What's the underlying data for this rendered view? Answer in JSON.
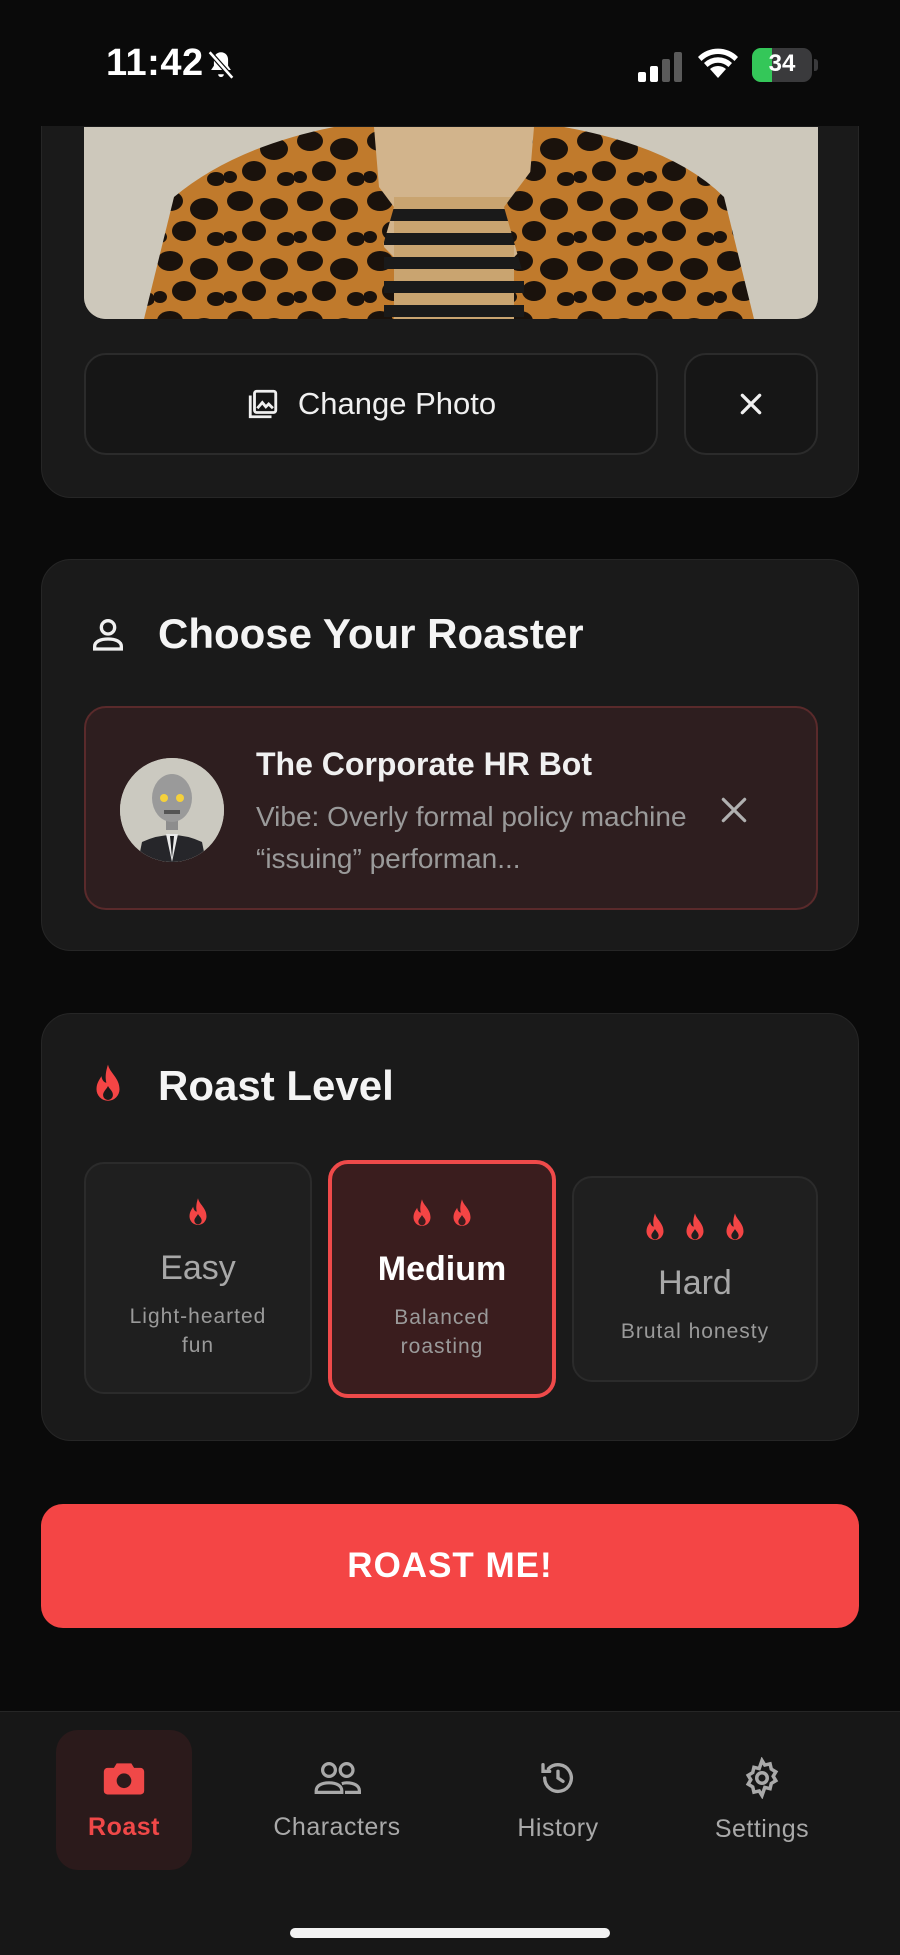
{
  "status_bar": {
    "time": "11:42",
    "battery": "34",
    "battery_fraction": 0.34
  },
  "photo_section": {
    "change_photo_label": "Change Photo"
  },
  "roaster_section": {
    "title": "Choose Your Roaster",
    "selected": {
      "name": "The Corporate HR Bot",
      "vibe": "Vibe: Overly formal policy machine “issuing” performan..."
    }
  },
  "roast_level": {
    "title": "Roast Level",
    "options": [
      {
        "name": "Easy",
        "description": "Light-hearted fun",
        "flames": 1,
        "selected": false
      },
      {
        "name": "Medium",
        "description": "Balanced roasting",
        "flames": 2,
        "selected": true
      },
      {
        "name": "Hard",
        "description": "Brutal honesty",
        "flames": 3,
        "selected": false
      }
    ]
  },
  "roast_button": {
    "label": "ROAST ME!"
  },
  "tab_bar": {
    "tabs": [
      {
        "label": "Roast",
        "icon": "camera-icon",
        "active": true
      },
      {
        "label": "Characters",
        "icon": "people-icon",
        "active": false
      },
      {
        "label": "History",
        "icon": "history-icon",
        "active": false
      },
      {
        "label": "Settings",
        "icon": "gear-icon",
        "active": false
      }
    ]
  },
  "colors": {
    "accent": "#f44545",
    "background": "#0a0a0a",
    "card": "#1a1a1a",
    "selected_bg": "#3a1d1e"
  }
}
